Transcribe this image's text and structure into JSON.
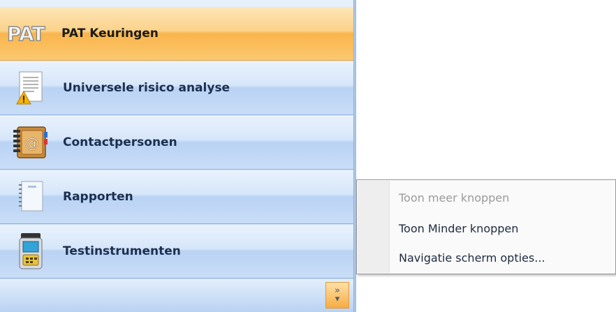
{
  "nav": {
    "items": [
      {
        "label": "PAT Keuringen",
        "icon": "pat-logo-icon",
        "logo_text": "PAT",
        "active": true
      },
      {
        "label": "Universele risico analyse",
        "icon": "document-warning-icon",
        "active": false
      },
      {
        "label": "Contactpersonen",
        "icon": "address-book-icon",
        "active": false
      },
      {
        "label": "Rapporten",
        "icon": "notepad-icon",
        "active": false
      },
      {
        "label": "Testinstrumenten",
        "icon": "test-instrument-icon",
        "active": false
      }
    ],
    "configure_glyph": "»",
    "configure_arrow": "▾"
  },
  "context_menu": {
    "items": [
      {
        "label": "Toon meer knoppen",
        "enabled": false
      },
      {
        "label": "Toon Minder knoppen",
        "enabled": true
      },
      {
        "label": "Navigatie scherm opties...",
        "enabled": true
      }
    ]
  },
  "colors": {
    "active_orange": "#f9b54c",
    "pane_blue": "#c7dcf5",
    "label_navy": "#1d2f4f"
  }
}
